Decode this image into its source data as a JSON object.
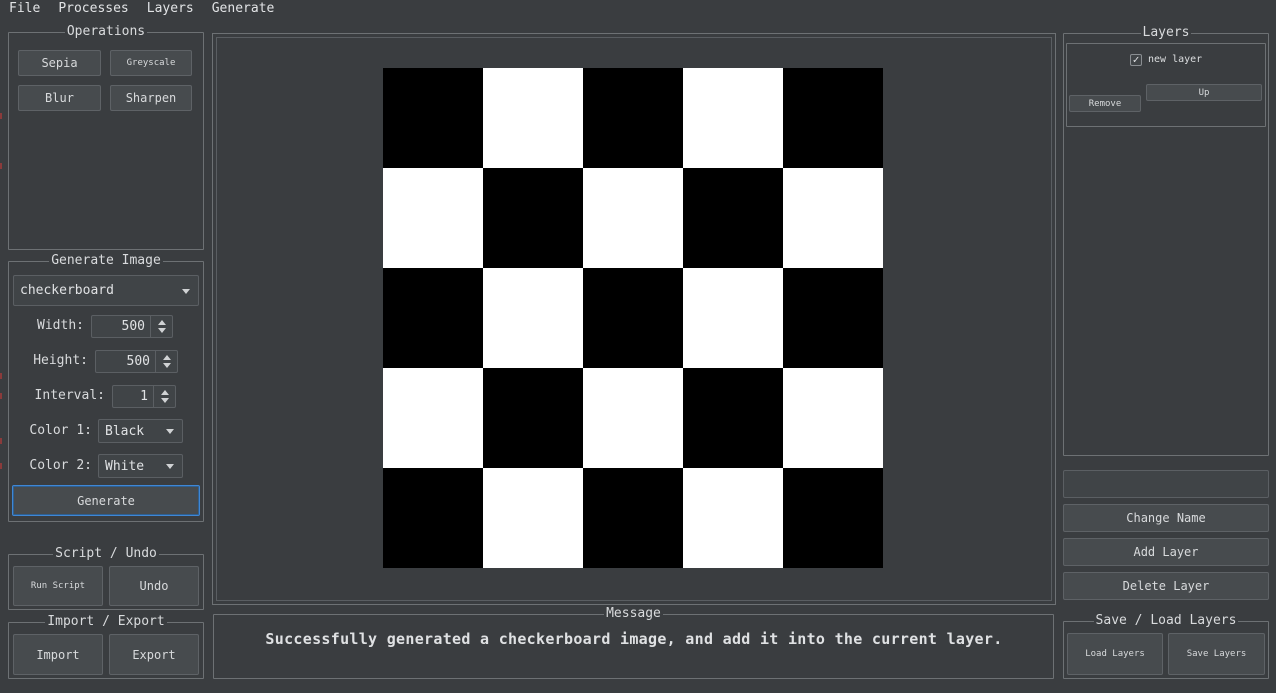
{
  "menubar": {
    "items": [
      "File",
      "Processes",
      "Layers",
      "Generate"
    ]
  },
  "operations": {
    "title": "Operations",
    "sepia": "Sepia",
    "greyscale": "Greyscale",
    "blur": "Blur",
    "sharpen": "Sharpen"
  },
  "generate_image": {
    "title": "Generate Image",
    "type": "checkerboard",
    "width_label": "Width:",
    "width_value": "500",
    "height_label": "Height:",
    "height_value": "500",
    "interval_label": "Interval:",
    "interval_value": "1",
    "color1_label": "Color 1:",
    "color1_value": "Black",
    "color2_label": "Color 2:",
    "color2_value": "White",
    "generate_button": "Generate"
  },
  "script_undo": {
    "title": "Script / Undo",
    "run_script": "Run Script",
    "undo": "Undo"
  },
  "import_export": {
    "title": "Import / Export",
    "import": "Import",
    "export": "Export"
  },
  "canvas": {
    "rows": 5,
    "cols": 5,
    "color1": "#000000",
    "color2": "#ffffff"
  },
  "message": {
    "title": "Message",
    "text": "Successfully generated a checkerboard image, and add it into the current layer."
  },
  "layers": {
    "title": "Layers",
    "items": [
      {
        "name": "new layer",
        "checked": true,
        "remove": "Remove",
        "up": "Up"
      }
    ],
    "name_input_value": "",
    "change_name": "Change Name",
    "add_layer": "Add Layer",
    "delete_layer": "Delete Layer"
  },
  "save_load": {
    "title": "Save / Load Layers",
    "load": "Load Layers",
    "save": "Save Layers"
  },
  "colors": {
    "background": "#3a3d40",
    "accent_focus": "#3f87d5"
  }
}
